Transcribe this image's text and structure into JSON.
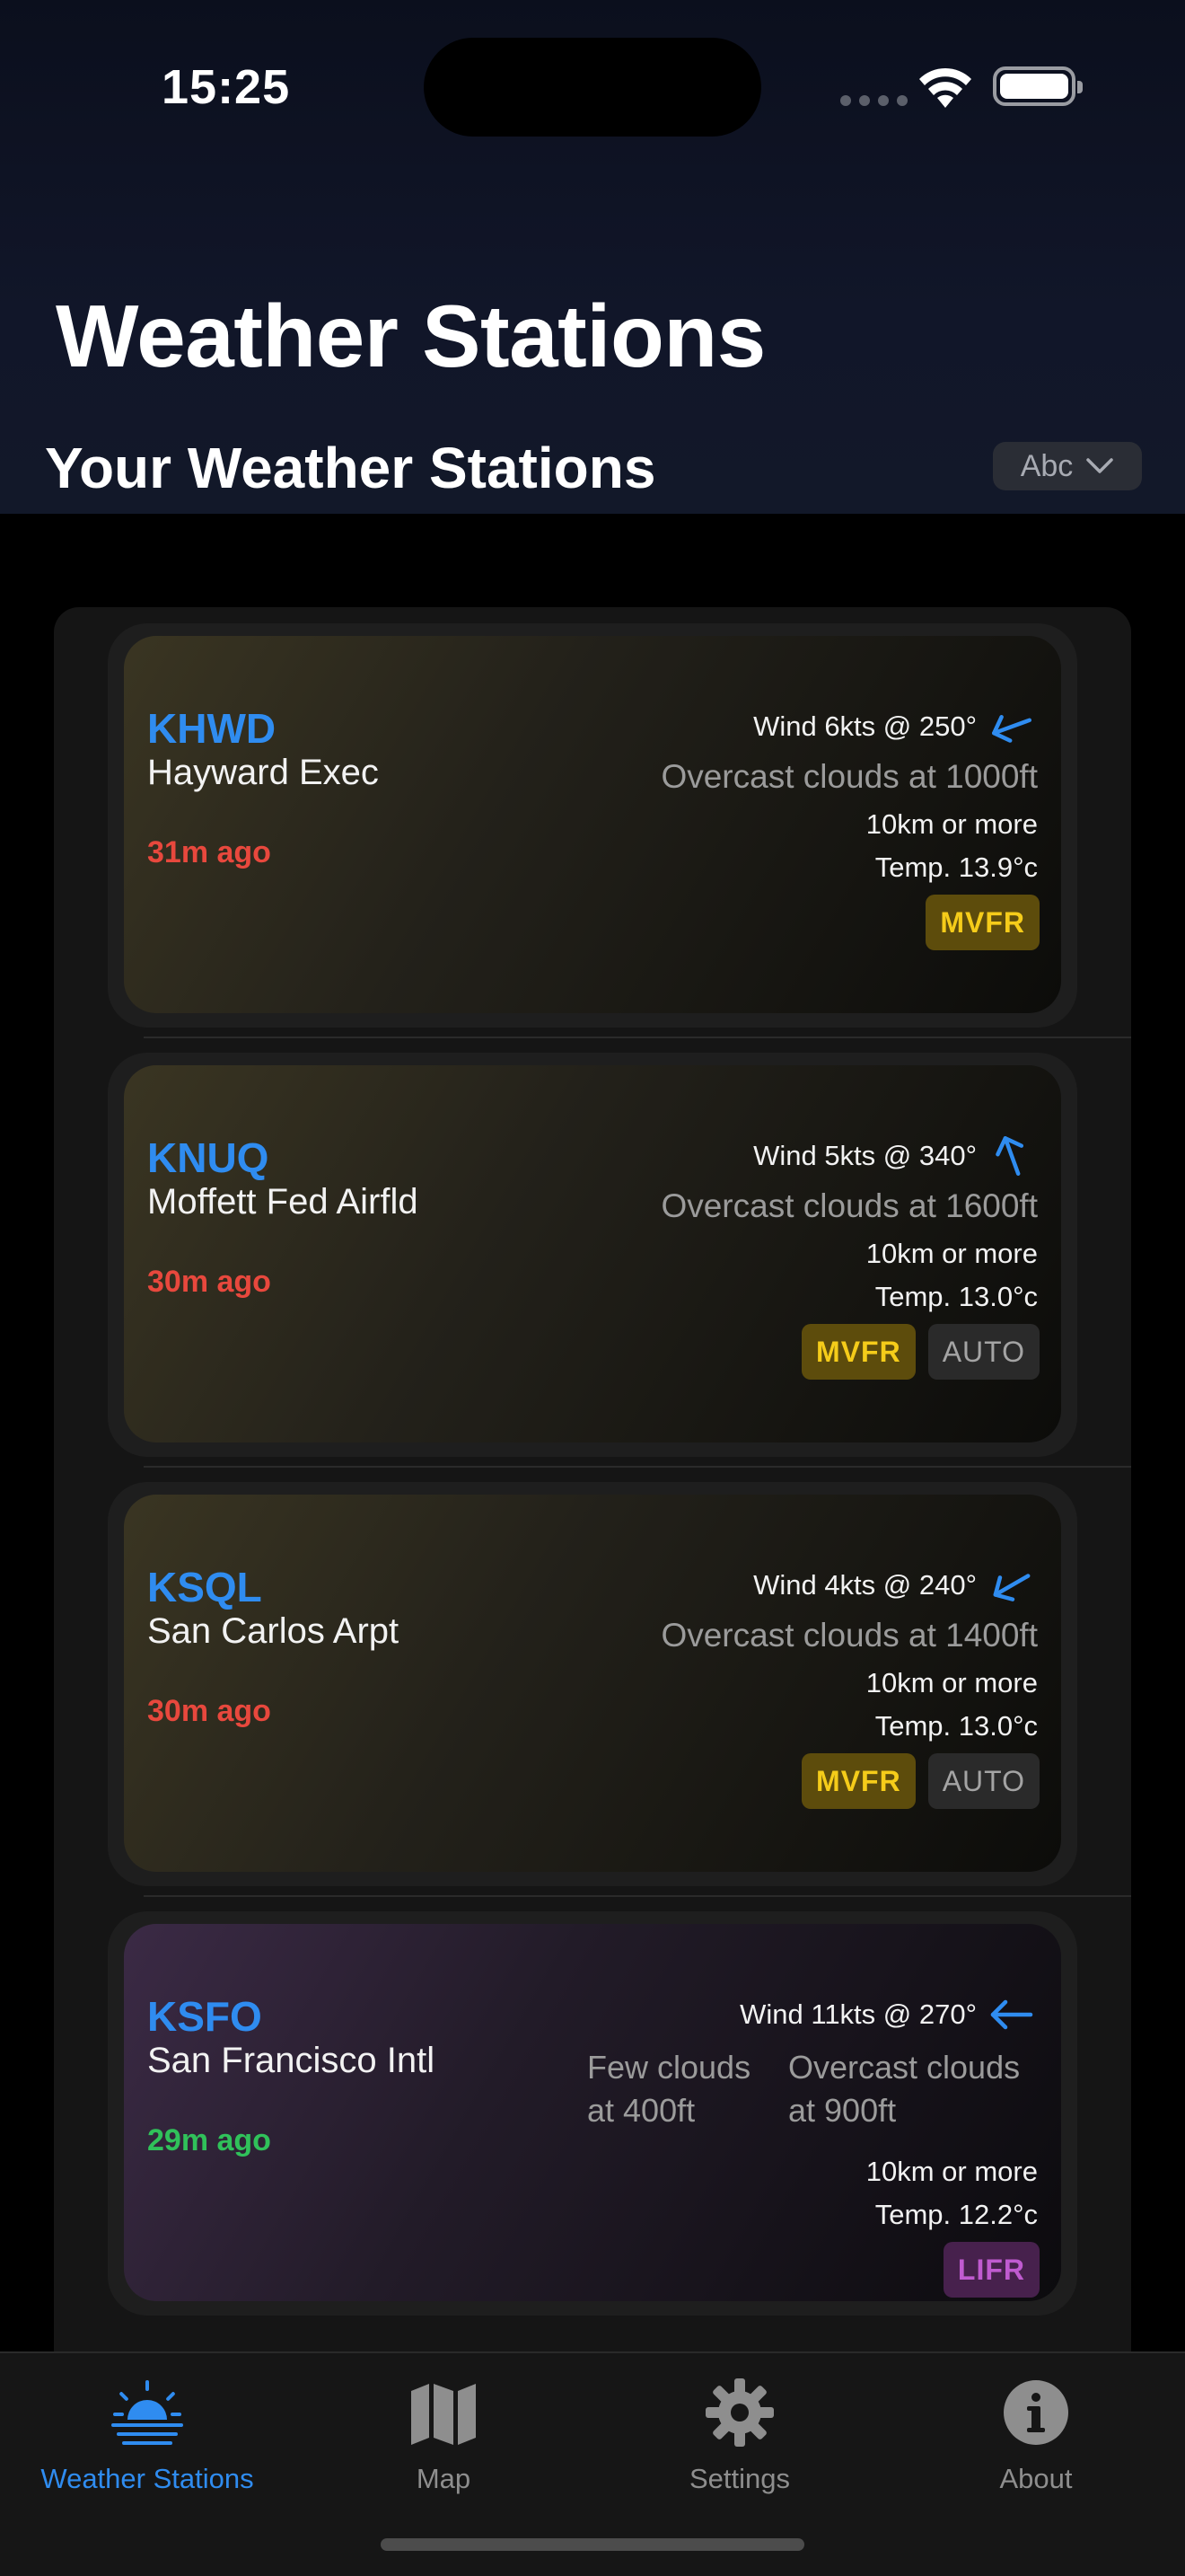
{
  "status_bar": {
    "time": "15:25"
  },
  "header": {
    "title": "Weather Stations",
    "section_title": "Your Weather Stations",
    "sort_label": "Abc"
  },
  "stations": [
    {
      "code": "KHWD",
      "name": "Hayward Exec",
      "age": "31m ago",
      "wind": "Wind 6kts @ 250°",
      "clouds": "Overcast clouds at 1000ft",
      "visibility": "10km or more",
      "temp": "Temp. 13.9°c",
      "category": "MVFR"
    },
    {
      "code": "KNUQ",
      "name": "Moffett Fed Airfld",
      "age": "30m ago",
      "wind": "Wind 5kts @ 340°",
      "clouds": "Overcast clouds at 1600ft",
      "visibility": "10km or more",
      "temp": "Temp. 13.0°c",
      "category": "MVFR",
      "auto": "AUTO"
    },
    {
      "code": "KSQL",
      "name": "San Carlos Arpt",
      "age": "30m ago",
      "wind": "Wind 4kts @ 240°",
      "clouds": "Overcast clouds at 1400ft",
      "visibility": "10km or more",
      "temp": "Temp. 13.0°c",
      "category": "MVFR",
      "auto": "AUTO"
    },
    {
      "code": "KSFO",
      "name": "San Francisco Intl",
      "age": "29m ago",
      "wind": "Wind 11kts @ 270°",
      "clouds_1": "Few clouds at 400ft",
      "clouds_2": "Overcast clouds at 900ft",
      "visibility": "10km or more",
      "temp": "Temp. 12.2°c",
      "category": "LIFR"
    }
  ],
  "tabs": [
    {
      "label": "Weather Stations",
      "icon": "sunrise-icon",
      "active": true
    },
    {
      "label": "Map",
      "icon": "map-icon"
    },
    {
      "label": "Settings",
      "icon": "gear-icon"
    },
    {
      "label": "About",
      "icon": "info-icon"
    }
  ],
  "colors": {
    "accent": "#2f8cf0",
    "mvfr": "#f5cc1a",
    "lifr": "#c05bd0",
    "stale": "#e8483d",
    "fresh": "#30c15a"
  }
}
